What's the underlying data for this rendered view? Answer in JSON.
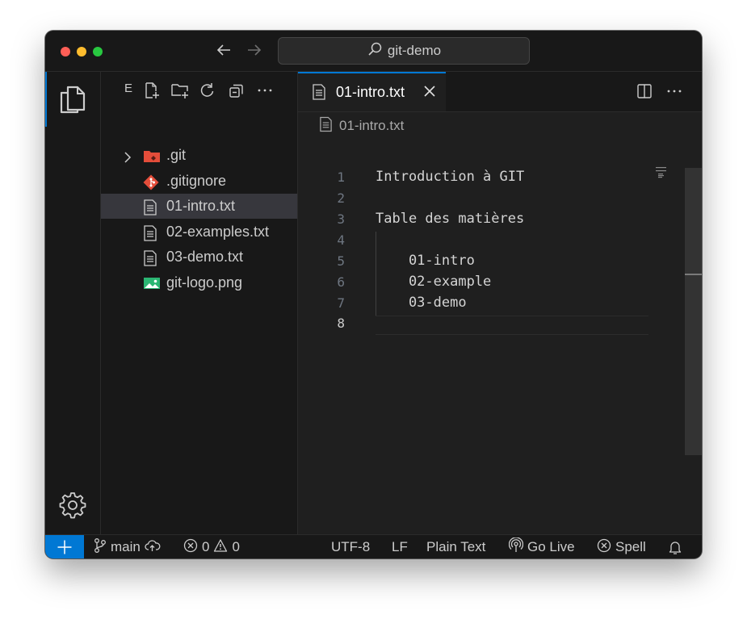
{
  "titlebar": {
    "search_text": "git-demo",
    "icons": {
      "back": "arrow-left-icon",
      "forward": "arrow-right-icon",
      "search": "search-icon"
    }
  },
  "activity_bar": {
    "items": [
      {
        "name": "explorer",
        "icon": "files-icon",
        "active": true
      },
      {
        "name": "manage",
        "icon": "gear-icon"
      }
    ]
  },
  "sidebar": {
    "header": "E",
    "tools": [
      "new-file-icon",
      "new-folder-icon",
      "refresh-icon",
      "collapse-all-icon",
      "more-icon"
    ],
    "tree": [
      {
        "label": ".git",
        "icon": "git-folder-icon",
        "kind": "folder",
        "collapsed": true
      },
      {
        "label": ".gitignore",
        "icon": "git-file-icon",
        "kind": "file"
      },
      {
        "label": "01-intro.txt",
        "icon": "text-file-icon",
        "kind": "file",
        "selected": true
      },
      {
        "label": "02-examples.txt",
        "icon": "text-file-icon",
        "kind": "file"
      },
      {
        "label": "03-demo.txt",
        "icon": "text-file-icon",
        "kind": "file"
      },
      {
        "label": "git-logo.png",
        "icon": "image-file-icon",
        "kind": "file"
      }
    ]
  },
  "editor": {
    "tab": {
      "label": "01-intro.txt",
      "icon": "text-file-icon"
    },
    "actions": [
      "split-editor-icon",
      "more-icon"
    ],
    "breadcrumb": "01-intro.txt",
    "active_line": 8,
    "lines": [
      {
        "num": "1",
        "text": "Introduction à GIT"
      },
      {
        "num": "2",
        "text": ""
      },
      {
        "num": "3",
        "text": "Table des matières"
      },
      {
        "num": "4",
        "text": ""
      },
      {
        "num": "5",
        "text": "    01-intro"
      },
      {
        "num": "6",
        "text": "    02-example"
      },
      {
        "num": "7",
        "text": "    03-demo"
      },
      {
        "num": "8",
        "text": ""
      }
    ]
  },
  "statusbar": {
    "branch": "main",
    "errors": "0",
    "warnings": "0",
    "encoding": "UTF-8",
    "eol": "LF",
    "language": "Plain Text",
    "go_live": "Go Live",
    "spell": "Spell"
  },
  "colors": {
    "accent": "#0078d4",
    "background": "#1f1f1f",
    "sidebar": "#181818",
    "selection": "#37373d",
    "git_icon": "#e44d3a",
    "image_icon": "#2bb673"
  }
}
